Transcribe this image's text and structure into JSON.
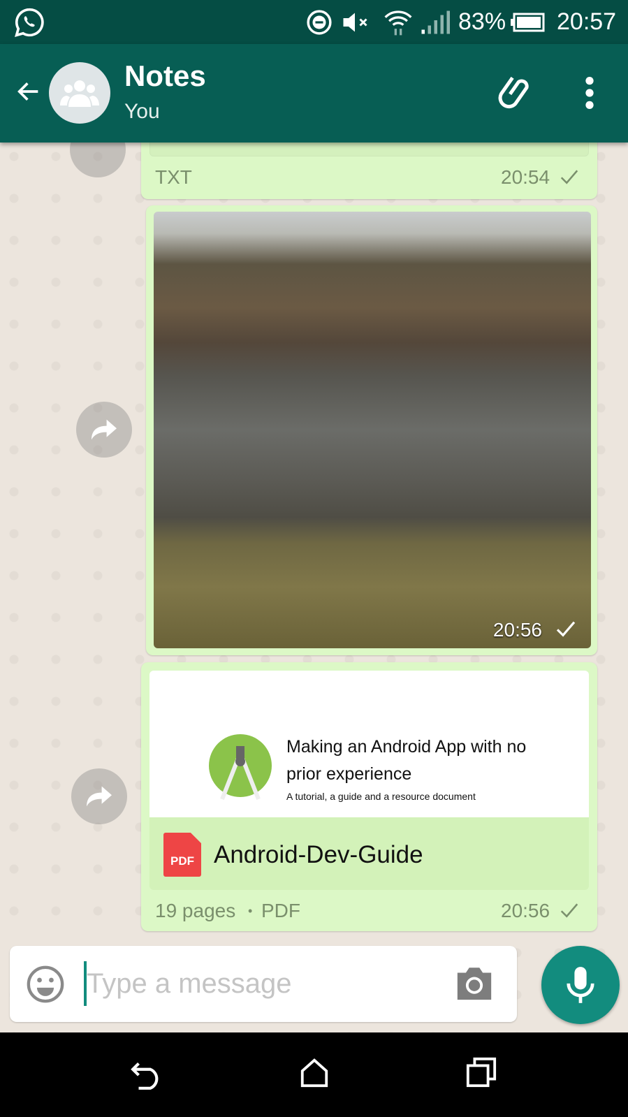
{
  "status_bar": {
    "battery": "83%",
    "time": "20:57",
    "icons": [
      "whatsapp-icon",
      "do-not-disturb-icon",
      "mute-icon",
      "wifi-icon",
      "signal-icon",
      "battery-icon"
    ]
  },
  "header": {
    "title": "Notes",
    "subtitle": "You",
    "icons": [
      "back-arrow-icon",
      "group-avatar-icon",
      "paperclip-icon",
      "more-vert-icon"
    ]
  },
  "messages": [
    {
      "type": "file",
      "file_type": "TXT",
      "time": "20:54",
      "status": "sent"
    },
    {
      "type": "image",
      "time": "20:56",
      "status": "sent"
    },
    {
      "type": "document",
      "preview_title": "Making an Android App with no prior experience",
      "preview_subtitle": "A tutorial, a guide and a resource document",
      "file_name": "Android-Dev-Guide",
      "pages": "19 pages",
      "separator": "•",
      "file_type": "PDF",
      "time": "20:56",
      "status": "sent",
      "badge": "PDF"
    }
  ],
  "composer": {
    "placeholder": "Type a message"
  },
  "colors": {
    "header": "#075e54",
    "status_bar": "#054d44",
    "bubble": "#dcf8c6",
    "mic": "#128c7e",
    "pdf": "#ee4545"
  }
}
